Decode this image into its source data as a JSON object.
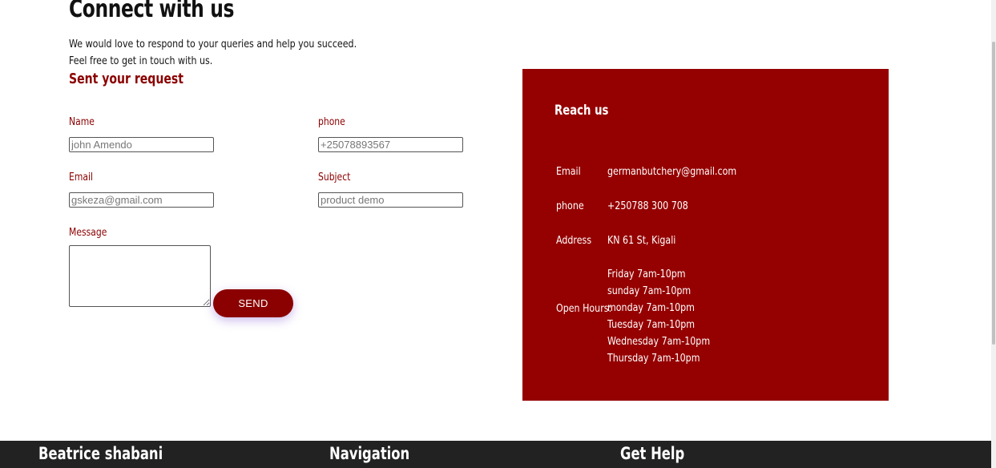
{
  "page": {
    "title": "Connect with us",
    "intro_line1": "We would love to respond to your queries and help you succeed.",
    "intro_line2": "Feel free to get in touch with us."
  },
  "form": {
    "title": "Sent your request",
    "name_label": "Name",
    "name_placeholder": "john Amendo",
    "phone_label": "phone",
    "phone_placeholder": "+25078893567",
    "email_label": "Email",
    "email_placeholder": "gskeza@gmail.com",
    "subject_label": "Subject",
    "subject_placeholder": "product demo",
    "message_label": "Message",
    "message_value": "",
    "send_label": "SEND"
  },
  "reach": {
    "title": "Reach us",
    "email_label": "Email",
    "email_value": "germanbutchery@gmail.com",
    "phone_label": "phone",
    "phone_value": "+250788 300 708",
    "address_label": "Address",
    "address_value": "KN 61 St, Kigali",
    "hours_label": "Open Hours:",
    "hours": [
      "Friday 7am-10pm",
      "sunday 7am-10pm",
      "monday 7am-10pm",
      "Tuesday 7am-10pm",
      "Wednesday 7am-10pm",
      "Thursday 7am-10pm"
    ]
  },
  "footer": {
    "col1_title": "Beatrice shabani",
    "col2_title": "Navigation",
    "col3_title": "Get Help"
  },
  "colors": {
    "accent": "#8b0000",
    "panel": "#950000",
    "footer": "#222222"
  }
}
